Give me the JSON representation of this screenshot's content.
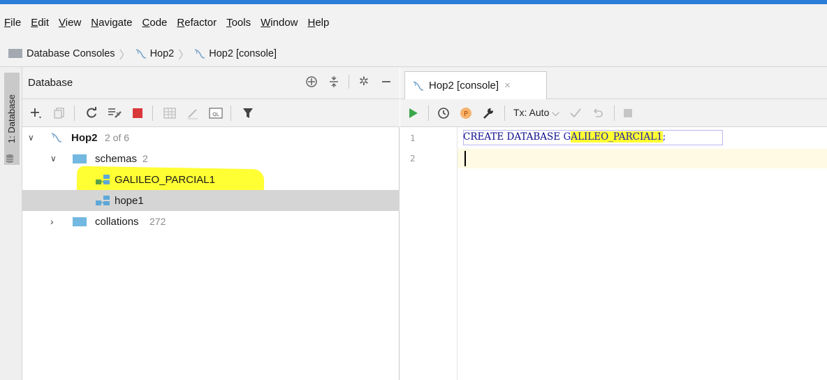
{
  "menubar": {
    "items": [
      {
        "mnemonic": "F",
        "rest": "ile"
      },
      {
        "mnemonic": "E",
        "rest": "dit"
      },
      {
        "mnemonic": "V",
        "rest": "iew"
      },
      {
        "mnemonic": "N",
        "rest": "avigate"
      },
      {
        "mnemonic": "C",
        "rest": "ode"
      },
      {
        "mnemonic": "R",
        "rest": "efactor"
      },
      {
        "mnemonic": "T",
        "rest": "ools"
      },
      {
        "mnemonic": "W",
        "rest": "indow"
      },
      {
        "mnemonic": "H",
        "rest": "elp"
      }
    ]
  },
  "breadcrumb": {
    "root": "Database Consoles",
    "datasource": "Hop2",
    "console": "Hop2 [console]"
  },
  "left_strip": {
    "tab_label": "1: Database"
  },
  "db_panel": {
    "title": "Database",
    "tree": {
      "datasource": {
        "name": "Hop2",
        "count": "2 of 6"
      },
      "schemas": {
        "name": "schemas",
        "count": "2"
      },
      "schema_items": [
        "GALILEO_PARCIAL1",
        "hope1"
      ],
      "collations": {
        "name": "collations",
        "count": "272"
      }
    }
  },
  "editor": {
    "tab_label": "Hop2 [console]",
    "tx_label": "Tx: Auto",
    "line_numbers": [
      "1",
      "2"
    ],
    "code": {
      "keywords": "CREATE DATABASE ",
      "identifier_first": "G",
      "identifier_highlighted": "ALILEO_PARCIAL1",
      "terminator": ";"
    }
  },
  "colors": {
    "accent_bar": "#2d7ed8",
    "highlight": "#ffff33",
    "run_green": "#3aa64a",
    "stop_red": "#d9383a",
    "schema_green": "#5aa048",
    "schema_blue": "#5ea8d8"
  }
}
